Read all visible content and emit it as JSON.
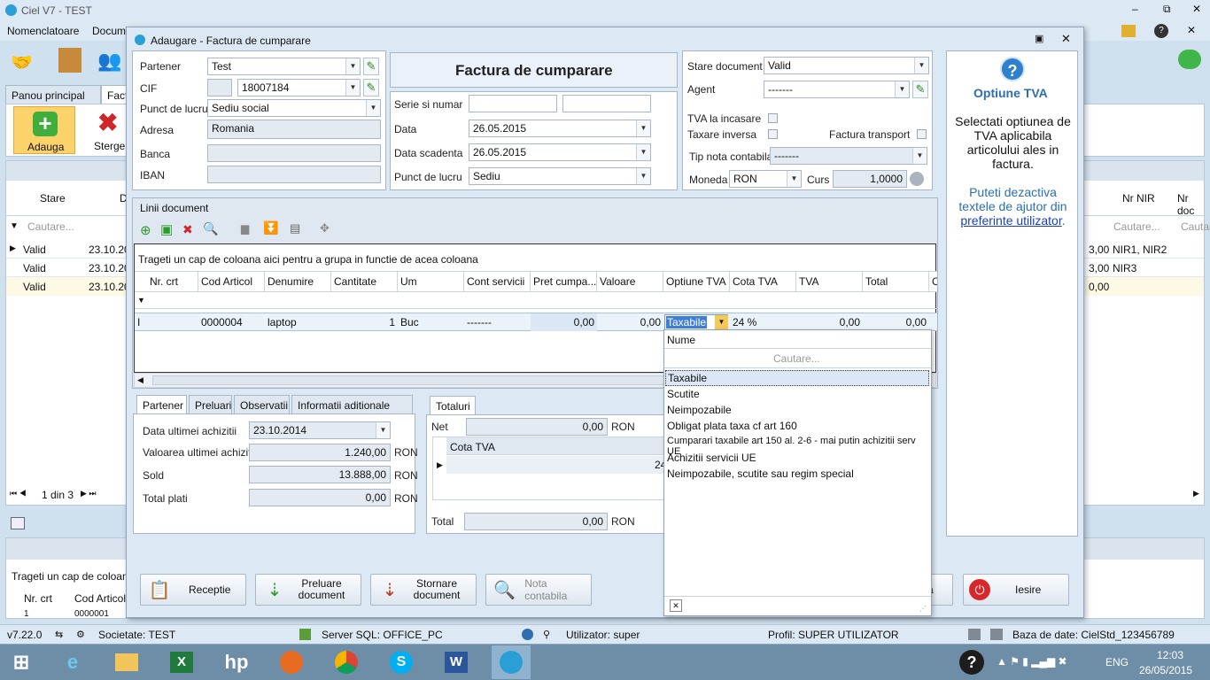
{
  "app": {
    "title": "Ciel V7 - TEST",
    "menu": [
      "Nomenclatoare",
      "Docum"
    ],
    "win_min": "–",
    "win_max": "⧉",
    "win_close": "✕"
  },
  "maintabs": [
    "Panou principal",
    "Fact"
  ],
  "ribbon": {
    "add": "Adauga",
    "delete": "Sterge"
  },
  "bg_grid": {
    "cols": [
      "Stare",
      "D",
      "Nr NIR",
      "Nr doc"
    ],
    "filter": "Cautare...",
    "rows": [
      {
        "stare": "Valid",
        "d": "23.10.20",
        "tail": "3,00",
        "nir": "NIR1, NIR2"
      },
      {
        "stare": "Valid",
        "d": "23.10.20",
        "tail": "3,00",
        "nir": "NIR3"
      },
      {
        "stare": "Valid",
        "d": "23.10.20",
        "tail": "0,00",
        "nir": ""
      }
    ],
    "pager": "1 din 3"
  },
  "bg_lower": {
    "grouping": "Trageti un cap de coloana",
    "cols": [
      "Nr. crt",
      "Cod Articol"
    ],
    "row": [
      "1",
      "0000001"
    ]
  },
  "dialog": {
    "title": "Adaugare - Factura de cumparare",
    "heading": "Factura de cumparare",
    "partner": {
      "partner_lbl": "Partener",
      "partner_val": "Test",
      "cif_lbl": "CIF",
      "cif_val": "18007184",
      "punct_lbl": "Punct de lucru",
      "punct_val": "Sediu social",
      "adresa_lbl": "Adresa",
      "adresa_val": "Romania",
      "banca_lbl": "Banca",
      "iban_lbl": "IBAN"
    },
    "doc": {
      "serie_lbl": "Serie si numar",
      "data_lbl": "Data",
      "data_val": "26.05.2015",
      "scad_lbl": "Data scadenta",
      "scad_val": "26.05.2015",
      "punct_lbl": "Punct de lucru",
      "punct_val": "Sediu"
    },
    "state": {
      "stare_lbl": "Stare document",
      "stare_val": "Valid",
      "agent_lbl": "Agent",
      "agent_val": "-------",
      "tva_inc": "TVA la incasare",
      "tax_inv": "Taxare inversa",
      "fact_transp": "Factura transport",
      "tip_nota": "Tip nota contabila",
      "tip_nota_val": "-------",
      "moneda_lbl": "Moneda",
      "moneda_val": "RON",
      "curs_lbl": "Curs",
      "curs_val": "1,0000"
    },
    "lines": {
      "label": "Linii document",
      "grouping": "Trageti un cap de coloana aici pentru a grupa in functie de acea coloana",
      "cols": [
        "Nr. crt",
        "Cod Articol",
        "Denumire",
        "Cantitate",
        "Um",
        "Cont servicii",
        "Pret cumpa...",
        "Valoare",
        "Optiune TVA",
        "Cota TVA",
        "TVA",
        "Total",
        "C"
      ],
      "row": {
        "cod": "0000004",
        "den": "laptop",
        "cant": "1",
        "um": "Buc",
        "cont": "-------",
        "pret": "0,00",
        "val": "0,00",
        "opt": "Taxabile",
        "cota": "24 %",
        "tva": "0,00",
        "total": "0,00"
      }
    },
    "subtabs": [
      "Partener",
      "Preluari",
      "Observatii",
      "Informatii aditionale"
    ],
    "ptab": {
      "l1": "Data ultimei achizitii",
      "v1": "23.10.2014",
      "l2": "Valoarea ultimei achizitii",
      "v2": "1.240,00",
      "l3": "Sold",
      "v3": "13.888,00",
      "l4": "Total plati",
      "v4": "0,00",
      "cur": "RON"
    },
    "totals": {
      "tab": "Totaluri",
      "net_lbl": "Net",
      "net_val": "0,00",
      "cur": "RON",
      "cota_hdr": "Cota TVA",
      "cota_cell": "24",
      "total_lbl": "Total",
      "total_val": "0,00"
    },
    "buttons": {
      "receptie": "Receptie",
      "preluare": "Preluare document",
      "stornare": "Stornare document",
      "nota": "Nota contabila",
      "ra": "ra",
      "iesire": "Iesire"
    },
    "help": {
      "title": "Optiune TVA",
      "text": "Selectati optiunea de TVA aplicabila articolului ales in factura.",
      "text2": "Puteti dezactiva textele de ajutor din ",
      "link": "preferinte utilizator",
      "dot": "."
    }
  },
  "dropdown": {
    "header": "Nume",
    "search": "Cautare...",
    "items": [
      "Taxabile",
      "Scutite",
      "Neimpozabile",
      "Obligat plata taxa cf art 160",
      "Cumparari taxabile art 150 al. 2-6 - mai putin achizitii serv UE",
      "Achizitii servicii UE",
      "Neimpozabile, scutite sau regim special"
    ],
    "selected": "Taxabile"
  },
  "status": {
    "version": "v7.22.0",
    "soc": "Societate: TEST",
    "server": "Server SQL: OFFICE_PC",
    "user": "Utilizator: super",
    "profil": "Profil: SUPER UTILIZATOR",
    "db": "Baza de date: CielStd_123456789"
  },
  "taskbar": {
    "lang": "ENG",
    "time": "12:03",
    "date": "26/05/2015"
  }
}
